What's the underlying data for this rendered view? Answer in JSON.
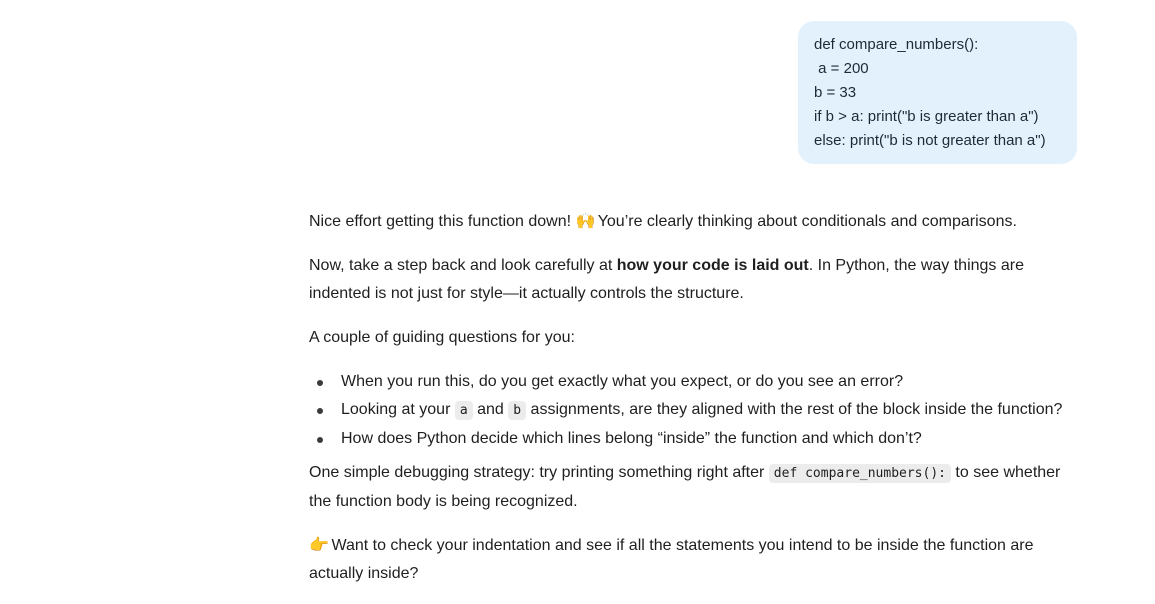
{
  "user_message": {
    "lines": [
      "def compare_numbers():",
      " a = 200",
      "b = 33",
      "if b > a: print(\"b is greater than a\")",
      "else: print(\"b is not greater than a\")"
    ]
  },
  "assistant": {
    "para1": {
      "before_emoji": "Nice effort getting this function down! ",
      "emoji": "🙌",
      "after_emoji": " You’re clearly thinking about conditionals and comparisons."
    },
    "para2": {
      "before_bold": "Now, take a step back and look carefully at ",
      "bold": "how your code is laid out",
      "after_bold": ". In Python, the way things are indented is not just for style—it actually controls the structure."
    },
    "para3": "A couple of guiding questions for you:",
    "bullets": {
      "b1": "When you run this, do you get exactly what you expect, or do you see an error?",
      "b2": {
        "t1": "Looking at your ",
        "code_a": "a",
        "t2": " and ",
        "code_b": "b",
        "t3": " assignments, are they aligned with the rest of the block inside the function?"
      },
      "b3": "How does Python decide which lines belong “inside” the function and which don’t?"
    },
    "para4": {
      "before_code": "One simple debugging strategy: try printing something right after ",
      "code": "def compare_numbers():",
      "after_code": " to see whether the function body is being recognized."
    },
    "para5": {
      "emoji": "👉",
      "text": " Want to check your indentation and see if all the statements you intend to be inside the function are actually inside?"
    }
  }
}
